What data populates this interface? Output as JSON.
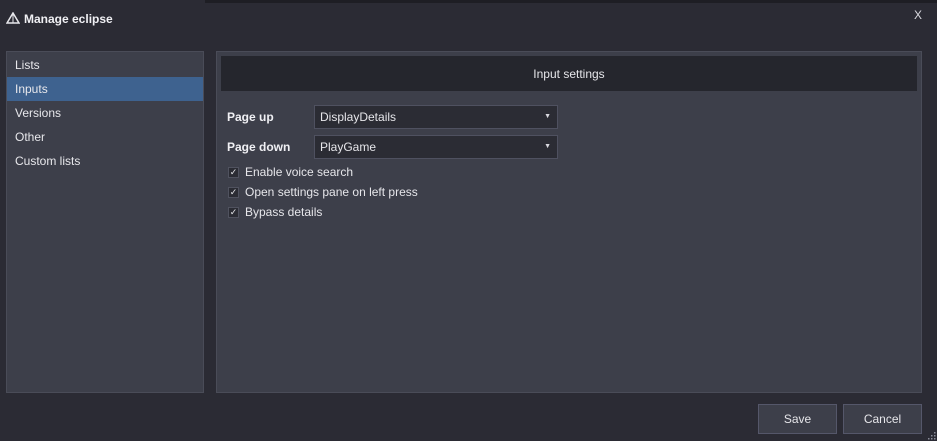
{
  "window": {
    "title": "Manage eclipse",
    "close_label": "X"
  },
  "sidebar": {
    "items": [
      {
        "label": "Lists",
        "active": false
      },
      {
        "label": "Inputs",
        "active": true
      },
      {
        "label": "Versions",
        "active": false
      },
      {
        "label": "Other",
        "active": false
      },
      {
        "label": "Custom lists",
        "active": false
      }
    ]
  },
  "panel": {
    "header": "Input settings",
    "page_up": {
      "label": "Page up",
      "value": "DisplayDetails"
    },
    "page_down": {
      "label": "Page down",
      "value": "PlayGame"
    },
    "options": [
      {
        "label": "Enable voice search",
        "checked": true
      },
      {
        "label": "Open settings pane on left press",
        "checked": true
      },
      {
        "label": "Bypass details",
        "checked": true
      }
    ]
  },
  "footer": {
    "save_label": "Save",
    "cancel_label": "Cancel"
  },
  "colors": {
    "background": "#2b2b34",
    "panel": "#3d3f4a",
    "header": "#25262d",
    "accent": "#3e628f"
  },
  "icons": {
    "app": "triangle-logo-icon",
    "dropdown": "caret-down-icon",
    "check": "checkmark-icon",
    "resize": "resize-grip-icon"
  }
}
